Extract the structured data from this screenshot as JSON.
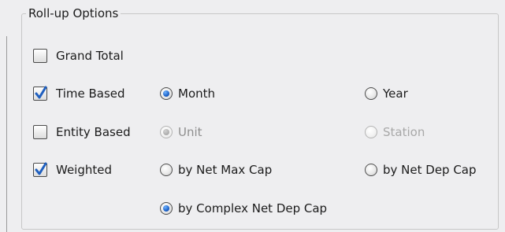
{
  "group": {
    "title": "Roll-up Options"
  },
  "options": {
    "grand_total": {
      "label": "Grand Total",
      "checked": false
    },
    "time_based": {
      "label": "Time Based",
      "checked": true,
      "month": {
        "label": "Month",
        "selected": true,
        "enabled": true
      },
      "year": {
        "label": "Year",
        "selected": false,
        "enabled": true
      }
    },
    "entity_based": {
      "label": "Entity Based",
      "checked": false,
      "unit": {
        "label": "Unit",
        "selected": true,
        "enabled": false
      },
      "station": {
        "label": "Station",
        "selected": false,
        "enabled": false
      }
    },
    "weighted": {
      "label": "Weighted",
      "checked": true,
      "net_max_cap": {
        "label": "by Net Max Cap",
        "selected": false,
        "enabled": true
      },
      "net_dep_cap": {
        "label": "by Net Dep Cap",
        "selected": false,
        "enabled": true
      },
      "complex_net_dep_cap": {
        "label": "by Complex Net Dep Cap",
        "selected": true,
        "enabled": true
      }
    }
  },
  "colors": {
    "checkmark": "#1f5fbf",
    "radio_selected": "#1d62c8",
    "disabled_text": "#8e8e8e"
  }
}
